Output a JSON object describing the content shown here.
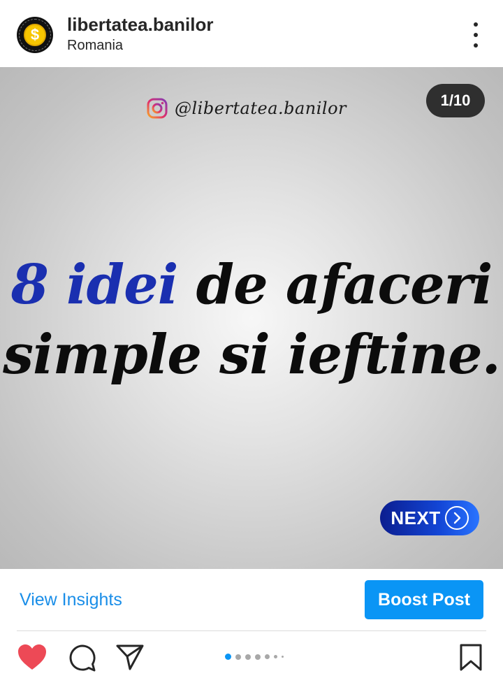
{
  "account": {
    "username": "libertatea.banilor",
    "location": "Romania",
    "avatar_symbol": "$"
  },
  "post": {
    "watermark_handle": "@libertatea.banilor",
    "counter": "1/10",
    "headline_accent": "8 idei",
    "headline_rest_line1": "de afaceri",
    "headline_line2": "simple si ieftine.",
    "next_label": "NEXT",
    "colors": {
      "accent_blue": "#1a2fb0",
      "next_gradient_start": "#0b1d8f",
      "next_gradient_end": "#2a74ff"
    }
  },
  "insights": {
    "view_label": "View Insights",
    "boost_label": "Boost Post",
    "link_color": "#1a8ee8",
    "boost_color": "#0a95f5"
  },
  "actions": {
    "icons": [
      "heart-icon",
      "comment-icon",
      "share-icon",
      "bookmark-icon"
    ],
    "like_color": "#ed4956",
    "carousel_active_index": 0
  }
}
